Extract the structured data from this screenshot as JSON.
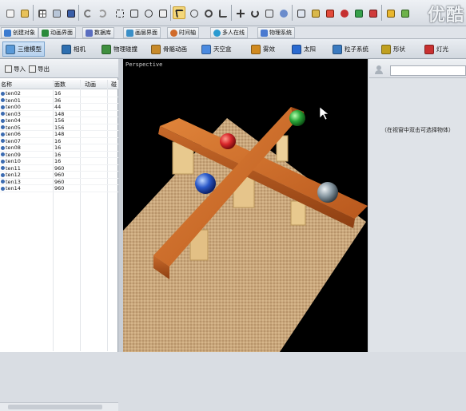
{
  "watermark": "优酷",
  "toolbar": {
    "buttons": [
      "new-file-icon",
      "open-file-icon",
      "save-file-icon",
      "grid-icon",
      "layers-icon",
      "table-icon",
      "undo-icon",
      "redo-icon",
      "select-icon",
      "rect-select-icon",
      "lasso-select-icon",
      "move-arrow-icon",
      "rotate-view-icon",
      "zoom-icon",
      "pan-icon",
      "translate-icon",
      "rotate-icon",
      "scale-icon",
      "render-icon",
      "camera-icon",
      "light-bulb-icon",
      "material-icon",
      "settings-icon",
      "help-icon",
      "preview-icon",
      "export-icon",
      "window-icon"
    ]
  },
  "tabs_row1": [
    {
      "label": "创建对象",
      "color": "#3b7bd0"
    },
    {
      "label": "动画界面",
      "color": "#2a8a3a"
    },
    {
      "label": "数据库",
      "color": "#5a6ec0"
    },
    {
      "label": "画层界面",
      "color": "#3a8fc7"
    },
    {
      "label": "时间轴",
      "color": "#d06b2a"
    },
    {
      "label": "多人在线",
      "color": "#2a9ad0"
    },
    {
      "label": "物理系统",
      "color": "#4a7ad0"
    }
  ],
  "tabs_row2": [
    {
      "label": "三维模型",
      "color": "#5a9ad8",
      "active": true
    },
    {
      "label": "相机",
      "color": "#2e6fb0"
    },
    {
      "label": "物理碰撞",
      "color": "#3f8f3f"
    },
    {
      "label": "骨骼动画",
      "color": "#c78a2a"
    },
    {
      "label": "天空盒",
      "color": "#4a8ae0"
    },
    {
      "label": "雾效",
      "color": "#d08a20"
    },
    {
      "label": "太阳",
      "color": "#2a6ad0"
    },
    {
      "label": "粒子系统",
      "color": "#3a7ac0"
    },
    {
      "label": "形状",
      "color": "#c0a020"
    },
    {
      "label": "灯光",
      "color": "#c83030"
    }
  ],
  "left_panel": {
    "import_label": "导入",
    "export_label": "导出",
    "columns": [
      "名称",
      "面数",
      "动画",
      "碰"
    ],
    "rows": [
      {
        "name": "ten02",
        "faces": "16"
      },
      {
        "name": "ten01",
        "faces": "36"
      },
      {
        "name": "ten00",
        "faces": "44"
      },
      {
        "name": "ten03",
        "faces": "148"
      },
      {
        "name": "ten04",
        "faces": "156"
      },
      {
        "name": "ten05",
        "faces": "156"
      },
      {
        "name": "ten06",
        "faces": "148"
      },
      {
        "name": "ten07",
        "faces": "16"
      },
      {
        "name": "ten08",
        "faces": "16"
      },
      {
        "name": "ten09",
        "faces": "16"
      },
      {
        "name": "ten10",
        "faces": "16"
      },
      {
        "name": "ten11",
        "faces": "960"
      },
      {
        "name": "ten12",
        "faces": "960"
      },
      {
        "name": "ten13",
        "faces": "960"
      },
      {
        "name": "ten14",
        "faces": "960"
      }
    ]
  },
  "viewport": {
    "label": "Perspective"
  },
  "right_panel": {
    "hint": "（在视窗中双击可选择物体）"
  }
}
